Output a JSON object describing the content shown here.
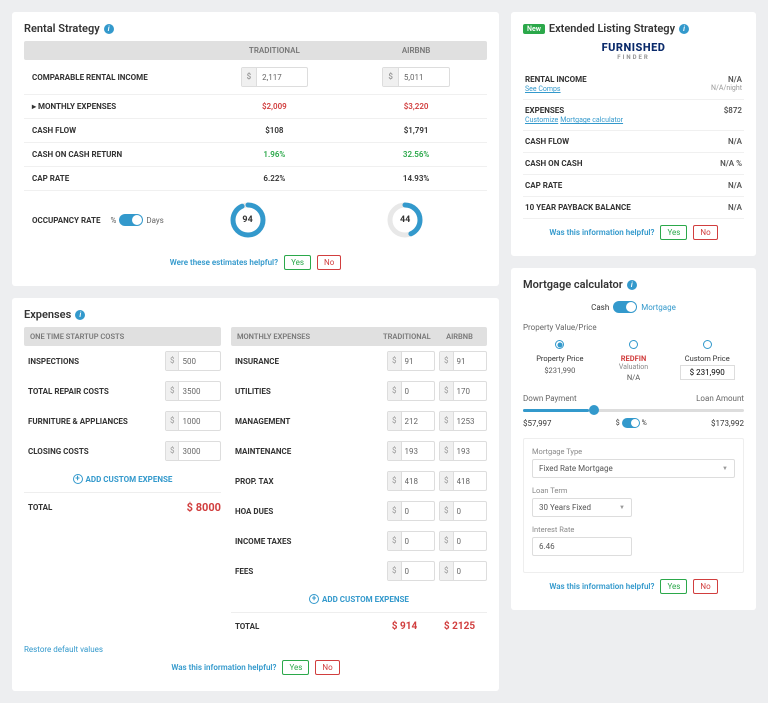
{
  "strategy": {
    "title": "Rental Strategy",
    "cols": {
      "trad": "TRADITIONAL",
      "airbnb": "AIRBNB"
    },
    "rows": {
      "income": {
        "label": "COMPARABLE RENTAL INCOME",
        "trad": "2,117",
        "airbnb": "5,011"
      },
      "monthly": {
        "label": "▸ MONTHLY EXPENSES",
        "trad": "$2,009",
        "airbnb": "$3,220"
      },
      "cashflow": {
        "label": "CASH FLOW",
        "trad": "$108",
        "airbnb": "$1,791"
      },
      "coc": {
        "label": "CASH ON CASH RETURN",
        "trad": "1.96%",
        "airbnb": "32.56%"
      },
      "cap": {
        "label": "CAP RATE",
        "trad": "6.22%",
        "airbnb": "14.93%"
      }
    },
    "occupancy": {
      "label": "OCCUPANCY RATE",
      "pct": "%",
      "days": "Days",
      "trad": "94",
      "airbnb": "44"
    }
  },
  "helpful": {
    "estimates": "Were these estimates helpful?",
    "info": "Was this information helpful?",
    "yes": "Yes",
    "no": "No"
  },
  "extended": {
    "badge": "New",
    "title": "Extended Listing Strategy",
    "logo": "FURNISHED",
    "logoSub": "FINDER",
    "rows": {
      "income": {
        "label": "RENTAL INCOME",
        "val": "N/A",
        "sub": "See Comps",
        "sub2": "N/A/night"
      },
      "expenses": {
        "label": "EXPENSES",
        "val": "$872",
        "sub": "Customize",
        "sub2": "Mortgage calculator"
      },
      "cashflow": {
        "label": "CASH FLOW",
        "val": "N/A"
      },
      "coc": {
        "label": "CASH ON CASH",
        "val": "N/A %"
      },
      "cap": {
        "label": "CAP RATE",
        "val": "N/A"
      },
      "payback": {
        "label": "10 YEAR PAYBACK BALANCE",
        "val": "N/A"
      }
    }
  },
  "expenses": {
    "title": "Expenses",
    "startupHeader": "ONE TIME STARTUP COSTS",
    "monthlyHeader": "MONTHLY EXPENSES",
    "tradHeader": "TRADITIONAL",
    "airbnbHeader": "AIRBNB",
    "startup": {
      "inspections": {
        "label": "INSPECTIONS",
        "val": "500"
      },
      "repair": {
        "label": "TOTAL REPAIR COSTS",
        "val": "3500"
      },
      "furniture": {
        "label": "FURNITURE & APPLIANCES",
        "val": "1000"
      },
      "closing": {
        "label": "CLOSING COSTS",
        "val": "3000"
      }
    },
    "monthly": {
      "insurance": {
        "label": "INSURANCE",
        "trad": "91",
        "airbnb": "91"
      },
      "utilities": {
        "label": "UTILITIES",
        "trad": "0",
        "airbnb": "170"
      },
      "management": {
        "label": "MANAGEMENT",
        "trad": "212",
        "airbnb": "1253"
      },
      "maintenance": {
        "label": "MAINTENANCE",
        "trad": "193",
        "airbnb": "193"
      },
      "proptax": {
        "label": "PROP. TAX",
        "trad": "418",
        "airbnb": "418"
      },
      "hoa": {
        "label": "HOA DUES",
        "trad": "0",
        "airbnb": "0"
      },
      "incometax": {
        "label": "INCOME TAXES",
        "trad": "0",
        "airbnb": "0"
      },
      "fees": {
        "label": "FEES",
        "trad": "0",
        "airbnb": "0"
      }
    },
    "addCustom": "ADD CUSTOM EXPENSE",
    "totalLabel": "TOTAL",
    "startupTotal": "$ 8000",
    "monthlyTotalTrad": "$ 914",
    "monthlyTotalAirbnb": "$ 2125",
    "restore": "Restore default values"
  },
  "mortgage": {
    "title": "Mortgage calculator",
    "cash": "Cash",
    "mortgageLabel": "Mortgage",
    "propValueLabel": "Property Value/Price",
    "options": {
      "prop": {
        "label": "Property Price",
        "val": "$231,990"
      },
      "redfin": {
        "label": "REDFIN",
        "sub": "Valuation",
        "val": "N/A"
      },
      "custom": {
        "label": "Custom Price",
        "val": "$ 231,990"
      }
    },
    "downPayment": "Down Payment",
    "loanAmount": "Loan Amount",
    "dpVal": "$57,997",
    "dpSym1": "$",
    "dpSym2": "%",
    "loanVal": "$173,992",
    "typeLabel": "Mortgage Type",
    "typeVal": "Fixed Rate Mortgage",
    "termLabel": "Loan Term",
    "termVal": "30 Years Fixed",
    "rateLabel": "Interest Rate",
    "rateVal": "6.46"
  }
}
